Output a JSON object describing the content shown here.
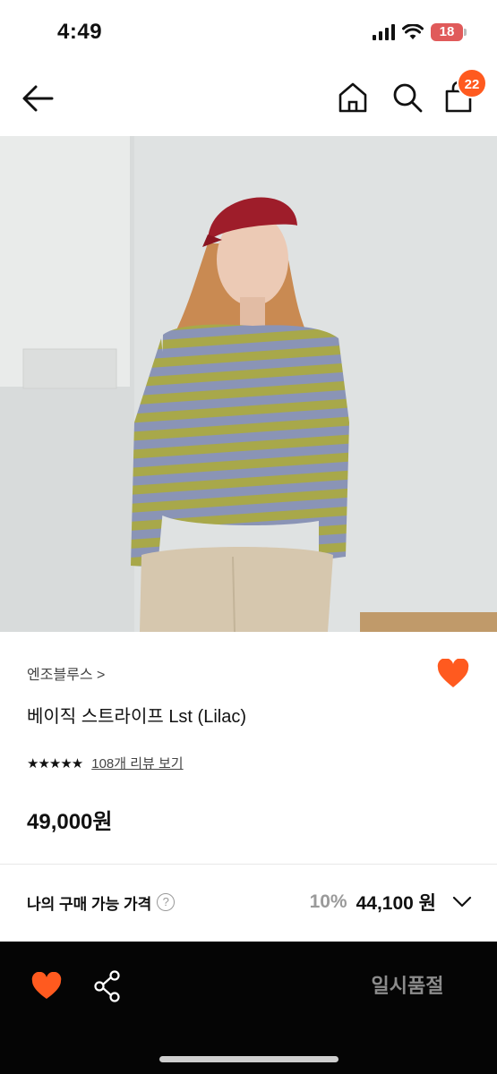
{
  "status_bar": {
    "time": "4:49",
    "battery": "18"
  },
  "nav": {
    "icons": [
      "back-arrow-icon",
      "home-icon",
      "search-icon",
      "cart-icon"
    ],
    "cart_count": "22"
  },
  "product": {
    "brand": "엔조블루스 >",
    "name": "베이직 스트라이프 Lst (Lilac)",
    "rating_stars": "★★★★★",
    "review_link": "108개 리뷰 보기",
    "price": "49,000원"
  },
  "my_price": {
    "label": "나의 구매 가능 가격",
    "help": "?",
    "discount": "10%",
    "price": "44,100 원"
  },
  "bottom_bar": {
    "sold_out_label": "일시품절"
  },
  "colors": {
    "accent": "#ff5a1f",
    "bottom_bar": "#050505"
  }
}
